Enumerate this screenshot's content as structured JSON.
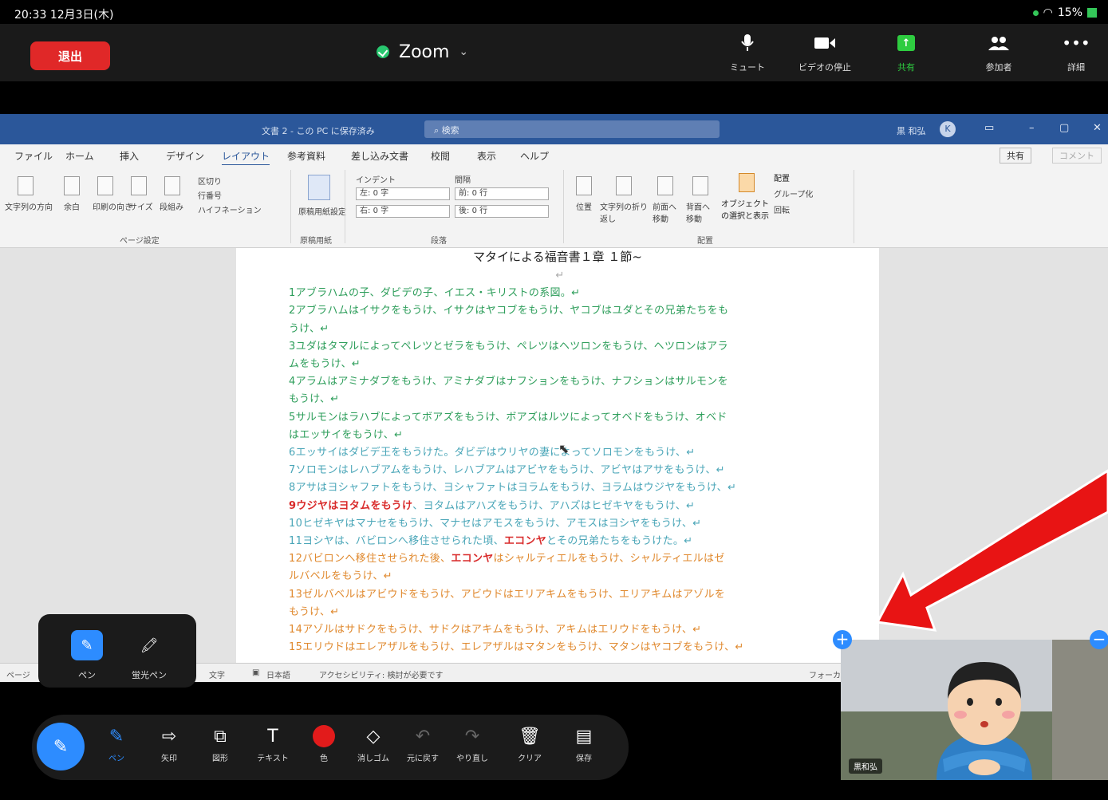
{
  "status_bar": {
    "time": "20:33",
    "date": "12月3日(木)",
    "battery": "15%"
  },
  "zoom": {
    "leave_label": "退出",
    "meeting_title": "Zoom",
    "toolbar": [
      {
        "id": "mute",
        "label": "ミュート",
        "icon": "microphone-icon"
      },
      {
        "id": "video",
        "label": "ビデオの停止",
        "icon": "video-camera-icon"
      },
      {
        "id": "share",
        "label": "共有",
        "icon": "share-screen-icon",
        "color": "#2ecc40"
      },
      {
        "id": "participants",
        "label": "参加者",
        "icon": "participants-icon"
      },
      {
        "id": "more",
        "label": "詳細",
        "icon": "more-dots-icon"
      }
    ]
  },
  "word": {
    "doc_name": "文書 2 - この PC に保存済み",
    "search_placeholder": "検索",
    "user_name": "黒 和弘",
    "user_initial": "K",
    "tabs": [
      "ファイル",
      "ホーム",
      "挿入",
      "デザイン",
      "レイアウト",
      "参考資料",
      "差し込み文書",
      "校閲",
      "表示",
      "ヘルプ"
    ],
    "active_tab": "レイアウト",
    "share_label": "共有",
    "comment_label": "コメント",
    "ribbon": {
      "page_setup": {
        "group_label": "ページ設定",
        "buttons": [
          "文字列の方向",
          "余白",
          "印刷の向き",
          "サイズ",
          "段組み"
        ],
        "small": [
          "区切り",
          "行番号",
          "ハイフネーション"
        ]
      },
      "genko": {
        "group_label": "原稿用紙",
        "button": "原稿用紙設定"
      },
      "paragraph": {
        "group_label": "段落",
        "indent_label": "インデント",
        "spacing_label": "間隔",
        "left_label": "左:",
        "left_value": "0 字",
        "right_label": "右:",
        "right_value": "0 字",
        "before_label": "前:",
        "before_value": "0 行",
        "after_label": "後:",
        "after_value": "0 行"
      },
      "arrange": {
        "group_label": "配置",
        "buttons": [
          "位置",
          "文字列の折り返し",
          "前面へ移動",
          "背面へ移動",
          "オブジェクトの選択と表示"
        ],
        "small": [
          "配置",
          "グループ化",
          "回転"
        ]
      }
    },
    "document": {
      "title": "マタイによる福音書１章 １節~",
      "lines": [
        {
          "text": "↵",
          "color": "para"
        },
        {
          "text": "1アブラハムの子、ダビデの子、イエス・キリストの系図。↵",
          "color": "green"
        },
        {
          "text": "2アブラハムはイサクをもうけ、イサクはヤコブをもうけ、ヤコブはユダとその兄弟たちをも",
          "color": "green"
        },
        {
          "text": "うけ、↵",
          "color": "green"
        },
        {
          "text": "3ユダはタマルによってペレツとゼラをもうけ、ペレツはヘツロンをもうけ、ヘツロンはアラ",
          "color": "green"
        },
        {
          "text": "ムをもうけ、↵",
          "color": "green"
        },
        {
          "text": "4アラムはアミナダブをもうけ、アミナダブはナフションをもうけ、ナフションはサルモンを",
          "color": "green"
        },
        {
          "text": "もうけ、↵",
          "color": "green"
        },
        {
          "text": "5サルモンはラハブによってボアズをもうけ、ボアズはルツによってオベドをもうけ、オベド",
          "color": "green"
        },
        {
          "text": "はエッサイをもうけ、↵",
          "color": "green"
        },
        {
          "text": "6エッサイはダビデ王をもうけた。ダビデはウリヤの妻によってソロモンをもうけ、↵",
          "color": "teal"
        },
        {
          "text": "7ソロモンはレハブアムをもうけ、レハブアムはアビヤをもうけ、アビヤはアサをもうけ、↵",
          "color": "teal"
        },
        {
          "text": "8アサはヨシャファトをもうけ、ヨシャファトはヨラムをもうけ、ヨラムはウジヤをもうけ、↵",
          "color": "teal"
        },
        {
          "text": "9ウジヤはヨタムをもうけ、ヨタムはアハズをもうけ、アハズはヒゼキヤをもうけ、↵",
          "color": "teal"
        },
        {
          "text": "10ヒゼキヤはマナセをもうけ、マナセはアモスをもうけ、アモスはヨシヤをもうけ、↵",
          "color": "teal"
        },
        {
          "text": "11ヨシヤは、バビロンへ移住させられた頃、エコンヤとその兄弟たちをもうけた。↵",
          "color": "teal"
        },
        {
          "text": "12バビロンへ移住させられた後、エコンヤはシャルティエルをもうけ、シャルティエルはゼ",
          "color": "orange"
        },
        {
          "text": "ルバベルをもうけ、↵",
          "color": "orange"
        },
        {
          "text": "13ゼルバベルはアビウドをもうけ、アビウドはエリアキムをもうけ、エリアキムはアゾルを",
          "color": "orange"
        },
        {
          "text": "もうけ、↵",
          "color": "orange"
        },
        {
          "text": "14アゾルはサドクをもうけ、サドクはアキムをもうけ、アキムはエリウドをもうけ、↵",
          "color": "orange"
        },
        {
          "text": "15エリウドはエレアザルをもうけ、エレアザルはマタンをもうけ、マタンはヤコブをもうけ、↵",
          "color": "orange"
        }
      ],
      "highlight_9": "9ウジヤはヨタムをもうけ",
      "highlight_11": "エコンヤ",
      "highlight_12": "エコンヤ"
    },
    "statusbar": {
      "page": "ページ",
      "words": "文字",
      "language": "日本語",
      "accessibility": "アクセシビリティ: 検討が必要です",
      "focus": "フォーカス"
    }
  },
  "video_tile": {
    "name": "黒和弘"
  },
  "pen_popup": [
    {
      "label": "ペン",
      "icon": "pen-icon",
      "selected": true
    },
    {
      "label": "蛍光ペン",
      "icon": "highlighter-icon",
      "selected": false
    }
  ],
  "annotation_toolbar": [
    {
      "label": "ペン",
      "icon": "pen-icon",
      "selected": true
    },
    {
      "label": "矢印",
      "icon": "arrow-icon"
    },
    {
      "label": "図形",
      "icon": "shapes-icon"
    },
    {
      "label": "テキスト",
      "icon": "text-icon"
    },
    {
      "label": "色",
      "icon": "color-icon",
      "color": "#e21b1b"
    },
    {
      "label": "消しゴム",
      "icon": "eraser-icon"
    },
    {
      "label": "元に戻す",
      "icon": "undo-icon"
    },
    {
      "label": "やり直し",
      "icon": "redo-icon"
    },
    {
      "label": "クリア",
      "icon": "trash-icon"
    },
    {
      "label": "保存",
      "icon": "save-icon"
    }
  ]
}
